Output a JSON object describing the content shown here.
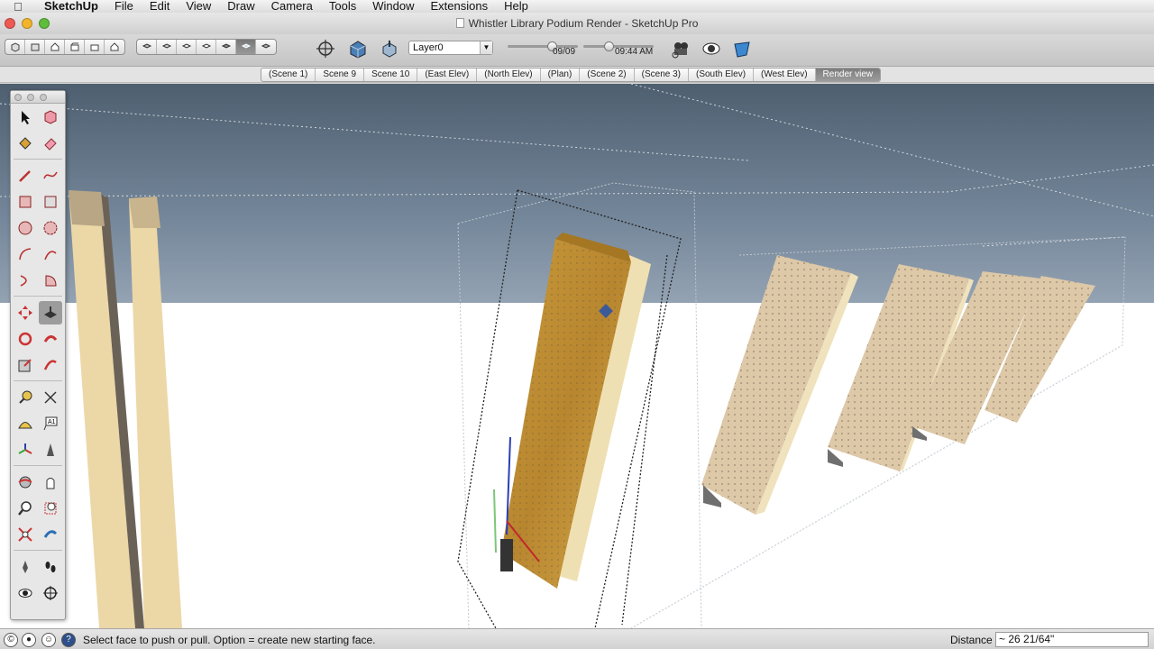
{
  "menubar": {
    "items": [
      "SketchUp",
      "File",
      "Edit",
      "View",
      "Draw",
      "Camera",
      "Tools",
      "Window",
      "Extensions",
      "Help"
    ]
  },
  "window": {
    "title": "Whistler Library Podium Render - SketchUp Pro"
  },
  "toolbar": {
    "layer_value": "Layer0",
    "date_label": "09/09",
    "time_label": "09:44 AM",
    "date_slider_level": 0.66,
    "time_slider_level": 0.35
  },
  "scenes": {
    "tabs": [
      "(Scene 1)",
      "Scene 9",
      "Scene 10",
      "(East Elev)",
      "(North Elev)",
      "(Plan)",
      "(Scene 2)",
      "(Scene 3)",
      "(South Elev)",
      "(West Elev)",
      "Render view"
    ],
    "active": "Render view"
  },
  "palette": {
    "tools": [
      [
        "select-tool-icon",
        "component-tool-icon"
      ],
      [
        "paint-bucket-icon",
        "eraser-icon"
      ],
      [
        "pencil-line-icon",
        "freehand-icon"
      ],
      [
        "rectangle-icon",
        "rotated-rectangle-icon"
      ],
      [
        "circle-icon",
        "polygon-icon"
      ],
      [
        "arc-icon",
        "two-point-arc-icon"
      ],
      [
        "three-point-arc-icon",
        "pie-icon"
      ],
      [
        "move-icon",
        "push-pull-icon"
      ],
      [
        "rotate-icon",
        "follow-me-icon"
      ],
      [
        "scale-icon",
        "offset-icon"
      ],
      [
        "tape-measure-icon",
        "dimension-icon"
      ],
      [
        "protractor-icon",
        "text-icon"
      ],
      [
        "axes-icon",
        "3d-text-icon"
      ],
      [
        "orbit-icon",
        "pan-icon"
      ],
      [
        "zoom-icon",
        "zoom-window-icon"
      ],
      [
        "zoom-extents-icon",
        "previous-view-icon"
      ],
      [
        "position-camera-icon",
        "walk-icon"
      ],
      [
        "look-around-icon",
        "section-plane-icon"
      ]
    ]
  },
  "status": {
    "message": "Select face to push or pull.  Option = create new starting face.",
    "measurement_label": "Distance",
    "measurement_value": "~ 26 21/64\""
  }
}
